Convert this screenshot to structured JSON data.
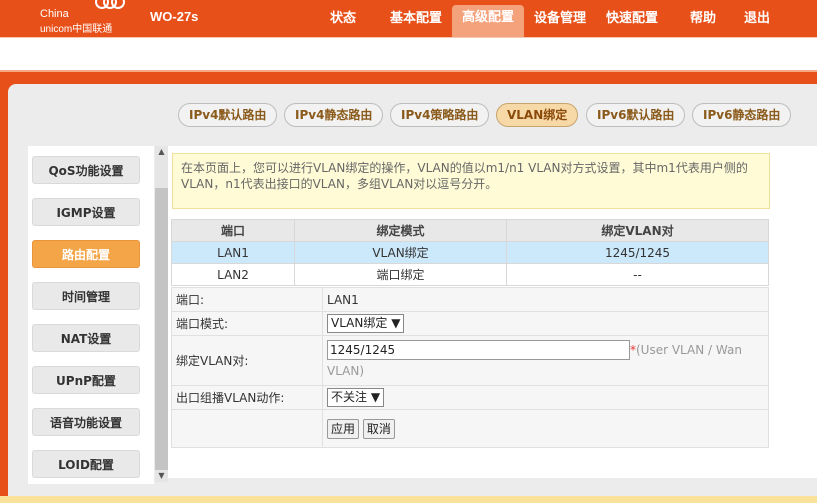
{
  "brand": {
    "line1": "China",
    "line2": "unicom中国联通",
    "model": "WO-27s"
  },
  "nav": [
    {
      "label": "状态"
    },
    {
      "label": "基本配置"
    },
    {
      "label": "高级配置"
    },
    {
      "label": "设备管理"
    },
    {
      "label": "快速配置"
    },
    {
      "label": "帮助"
    },
    {
      "label": "退出"
    }
  ],
  "tabs": [
    {
      "label": "IPv4默认路由"
    },
    {
      "label": "IPv4静态路由"
    },
    {
      "label": "IPv4策略路由"
    },
    {
      "label": "VLAN绑定"
    },
    {
      "label": "IPv6默认路由"
    },
    {
      "label": "IPv6静态路由"
    }
  ],
  "sidebar": [
    {
      "label": "QoS功能设置"
    },
    {
      "label": "IGMP设置"
    },
    {
      "label": "路由配置"
    },
    {
      "label": "时间管理"
    },
    {
      "label": "NAT设置"
    },
    {
      "label": "UPnP配置"
    },
    {
      "label": "语音功能设置"
    },
    {
      "label": "LOID配置"
    }
  ],
  "info_text": "在本页面上，您可以进行VLAN绑定的操作，VLAN的值以m1/n1 VLAN对方式设置，其中m1代表用户侧的VLAN，n1代表出接口的VLAN，多组VLAN对以逗号分开。",
  "table": {
    "headers": [
      "端口",
      "绑定模式",
      "绑定VLAN对"
    ],
    "rows": [
      [
        "LAN1",
        "VLAN绑定",
        "1245/1245"
      ],
      [
        "LAN2",
        "端口绑定",
        "--"
      ]
    ]
  },
  "form": {
    "port_label": "端口:",
    "port_value": "LAN1",
    "mode_label": "端口模式:",
    "mode_value": "VLAN绑定",
    "vlan_label": "绑定VLAN对:",
    "vlan_value": "1245/1245",
    "vlan_required": "*",
    "vlan_hint_1": "(User VLAN / Wan",
    "vlan_hint_2": "VLAN)",
    "mcast_label": "出口组播VLAN动作:",
    "mcast_value": "不关注",
    "apply": "应用",
    "cancel": "取消"
  },
  "colors": {
    "brand_orange": "#e8501a",
    "active_sidebar": "#f4a548",
    "selected_row": "#cce8fb",
    "info_bg": "#fffbd6"
  }
}
